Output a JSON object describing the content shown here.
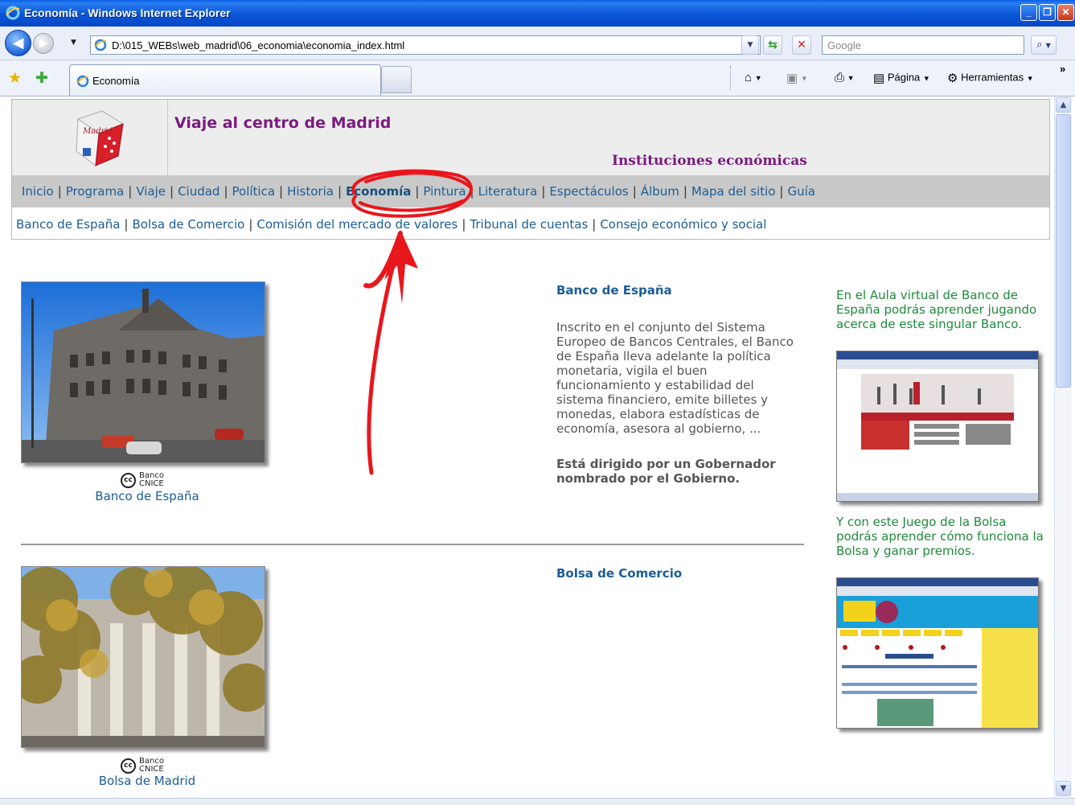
{
  "window": {
    "title": "Economía - Windows Internet Explorer"
  },
  "address_bar": {
    "url": "D:\\015_WEBs\\web_madrid\\06_economia\\economia_index.html"
  },
  "search_box": {
    "placeholder": "Google"
  },
  "tab": {
    "label": "Economía"
  },
  "command_bar": {
    "pagina": "Página",
    "herramientas": "Herramientas",
    "overflow": "»"
  },
  "page": {
    "site_title": "Viaje al centro de Madrid",
    "section_title": "Instituciones económicas",
    "main_menu": [
      {
        "label": "Inicio",
        "active": false
      },
      {
        "label": "Programa",
        "active": false
      },
      {
        "label": "Viaje",
        "active": false
      },
      {
        "label": "Ciudad",
        "active": false
      },
      {
        "label": "Política",
        "active": false
      },
      {
        "label": "Historia",
        "active": false
      },
      {
        "label": "Economía",
        "active": true
      },
      {
        "label": "Pintura",
        "active": false
      },
      {
        "label": "Literatura",
        "active": false
      },
      {
        "label": "Espectáculos",
        "active": false
      },
      {
        "label": "Álbum",
        "active": false
      },
      {
        "label": "Mapa del sitio",
        "active": false
      },
      {
        "label": "Guía",
        "active": false
      }
    ],
    "sub_menu": [
      "Banco de España",
      "Bolsa de Comercio",
      "Comisión del mercado de valores",
      "Tribunal de cuentas",
      "Consejo económico y social"
    ],
    "cc_label_1": "Banco",
    "cc_label_2": "CNICE",
    "entries": [
      {
        "caption": "Banco de España",
        "heading": "Banco de España",
        "text": "Inscrito en el conjunto del Sistema Europeo de Bancos Centrales, el Banco de España lleva adelante la política monetaria, vigila el buen funcionamiento y estabilidad del sistema financiero, emite billetes y monedas, elabora estadísticas de economía, asesora al gobierno, ...",
        "bold_text": "Está dirigido por un Gobernador nombrado por el Gobierno."
      },
      {
        "caption": "Bolsa de Madrid",
        "heading": "Bolsa de Comercio"
      }
    ],
    "sidebar": [
      {
        "text": "En el Aula virtual de Banco de España podrás aprender jugando acerca de este singular Banco."
      },
      {
        "text": "Y con este Juego de la Bolsa podrás aprender cómo funciona la Bolsa y ganar premios."
      }
    ]
  },
  "colors": {
    "site_title": "#7a1b7e",
    "link": "#1b5d96",
    "sidebar_text": "#1f8a3b",
    "annotation": "#e8171c"
  }
}
